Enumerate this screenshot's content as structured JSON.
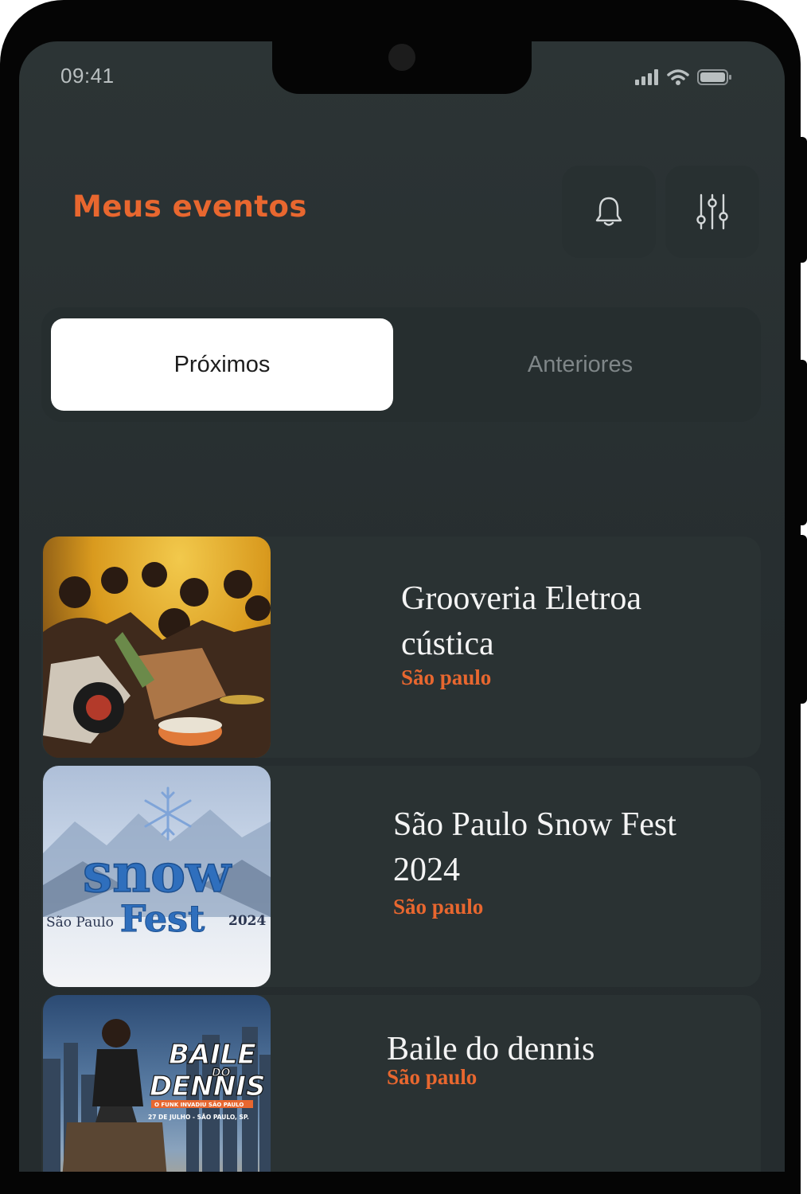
{
  "status_bar": {
    "time": "09:41"
  },
  "header": {
    "title": "Meus eventos",
    "notification_icon": "bell-icon",
    "filter_icon": "sliders-icon"
  },
  "tabs": [
    {
      "label": "Próximos",
      "active": true
    },
    {
      "label": "Anteriores",
      "active": false
    }
  ],
  "events": [
    {
      "name": "Grooveria Eletroa cústica",
      "city": "São paulo"
    },
    {
      "name": "São Paulo Snow Fest 2024",
      "city": "São paulo",
      "poster": {
        "word1": "snow",
        "word2": "Fest",
        "left": "São Paulo",
        "right": "2024"
      }
    },
    {
      "name": "Baile do dennis",
      "city": "São paulo",
      "poster": {
        "line1": "BAILE",
        "line2": "DO",
        "line3": "DENNIS",
        "tagline": "O FUNK INVADIU SÃO PAULO",
        "date": "27 DE JULHO - SÃO PAULO, SP."
      }
    }
  ],
  "colors": {
    "accent": "#e8672f",
    "background": "#2a3233",
    "active_tab": "#ffffff"
  }
}
